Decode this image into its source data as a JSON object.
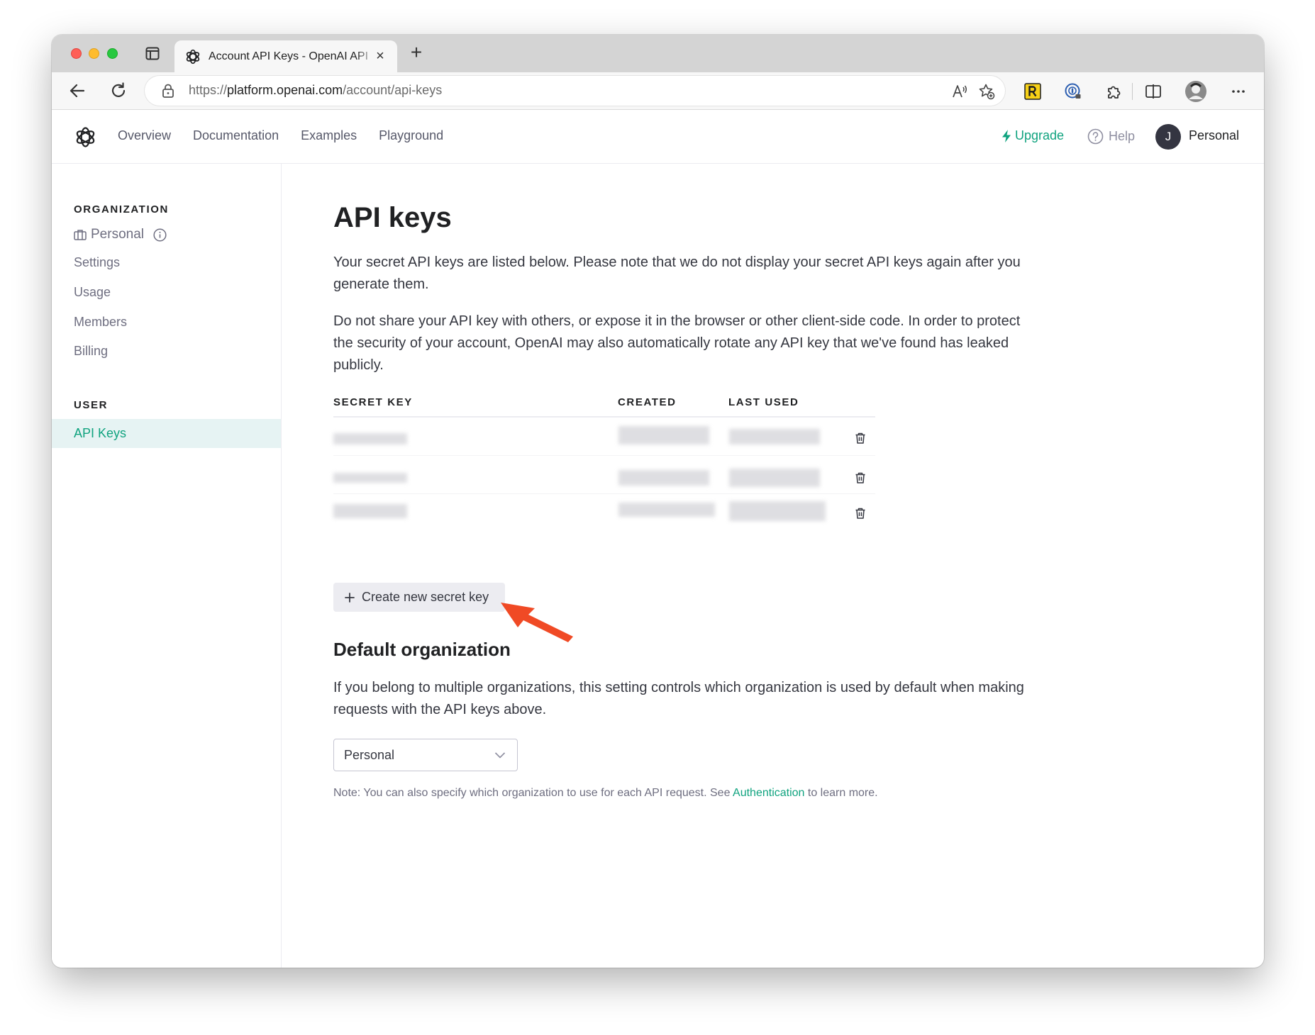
{
  "browser": {
    "tab_title": "Account API Keys - OpenAI API",
    "url_scheme": "https://",
    "url_host": "platform.openai.com",
    "url_path": "/account/api-keys",
    "new_tab_glyph": "+",
    "close_glyph": "×",
    "toolbar_icons": [
      "back-icon",
      "reload-icon",
      "lock-icon",
      "read-aloud-icon",
      "favorites-icon",
      "rakuten-extension-icon",
      "password-extension-icon",
      "extensions-icon",
      "split-screen-icon",
      "profile-icon",
      "more-icon"
    ]
  },
  "header": {
    "nav": [
      "Overview",
      "Documentation",
      "Examples",
      "Playground"
    ],
    "upgrade": "Upgrade",
    "help": "Help",
    "avatar_initial": "J",
    "account": "Personal"
  },
  "sidebar": {
    "org_heading": "ORGANIZATION",
    "org_name": "Personal",
    "org_items": [
      "Settings",
      "Usage",
      "Members",
      "Billing"
    ],
    "user_heading": "USER",
    "active_item": "API Keys"
  },
  "main": {
    "title": "API keys",
    "intro": "Your secret API keys are listed below. Please note that we do not display your secret API keys again after you generate them.",
    "warning": "Do not share your API key with others, or expose it in the browser or other client-side code. In order to protect the security of your account, OpenAI may also automatically rotate any API key that we've found has leaked publicly.",
    "table": {
      "headers": [
        "SECRET KEY",
        "CREATED",
        "LAST USED"
      ],
      "row_count_note": "3 rows, values redacted"
    },
    "create_button": "Create new secret key",
    "default_org_title": "Default organization",
    "default_org_text": "If you belong to multiple organizations, this setting controls which organization is used by default when making requests with the API keys above.",
    "org_select_value": "Personal",
    "note_prefix": "Note: You can also specify which organization to use for each API request. See ",
    "note_link": "Authentication",
    "note_suffix": " to learn more."
  },
  "colors": {
    "accent": "#10a37f",
    "annotation_arrow": "#f04a25",
    "sidebar_active_bg": "#e6f3f3"
  }
}
